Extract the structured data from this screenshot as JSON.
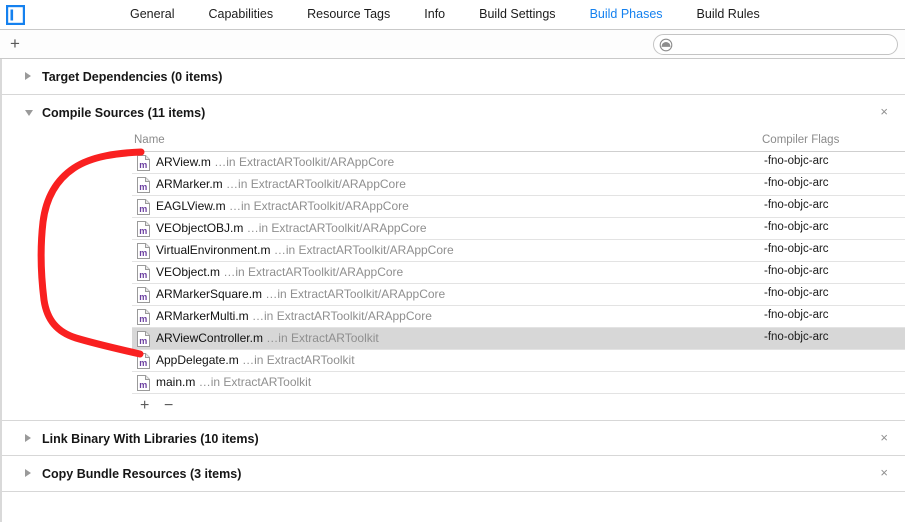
{
  "window": {
    "project_icon": "project-navigator-icon"
  },
  "tabs": [
    {
      "label": "General",
      "active": false
    },
    {
      "label": "Capabilities",
      "active": false
    },
    {
      "label": "Resource Tags",
      "active": false
    },
    {
      "label": "Info",
      "active": false
    },
    {
      "label": "Build Settings",
      "active": false
    },
    {
      "label": "Build Phases",
      "active": true
    },
    {
      "label": "Build Rules",
      "active": false
    }
  ],
  "toolbar": {
    "add_phase_label": "+",
    "add_phase_icon": "plus-icon",
    "search_icon": "filter-circle-icon",
    "search_value": "",
    "search_placeholder": ""
  },
  "phases": [
    {
      "name": "target-dependencies",
      "title": "Target Dependencies (0 items)",
      "expanded": false,
      "closable": false,
      "close_label": ""
    },
    {
      "name": "compile-sources",
      "title": "Compile Sources (11 items)",
      "expanded": true,
      "closable": true,
      "close_label": "×"
    },
    {
      "name": "link-binary-with-libraries",
      "title": "Link Binary With Libraries (10 items)",
      "expanded": false,
      "closable": true,
      "close_label": "×"
    },
    {
      "name": "copy-bundle-resources",
      "title": "Copy Bundle Resources (3 items)",
      "expanded": false,
      "closable": true,
      "close_label": "×"
    }
  ],
  "file_table": {
    "columns": [
      "Name",
      "Compiler Flags"
    ],
    "footer": {
      "add_label": "+",
      "remove_label": "−"
    },
    "rows": [
      {
        "icon": "objc-m-file-icon",
        "name": "ARView.m",
        "path": "…in ExtractARToolkit/ARAppCore",
        "flags": "-fno-objc-arc",
        "selected": false
      },
      {
        "icon": "objc-m-file-icon",
        "name": "ARMarker.m",
        "path": "…in ExtractARToolkit/ARAppCore",
        "flags": "-fno-objc-arc",
        "selected": false
      },
      {
        "icon": "objc-m-file-icon",
        "name": "EAGLView.m",
        "path": "…in ExtractARToolkit/ARAppCore",
        "flags": "-fno-objc-arc",
        "selected": false
      },
      {
        "icon": "objc-m-file-icon",
        "name": "VEObjectOBJ.m",
        "path": "…in ExtractARToolkit/ARAppCore",
        "flags": "-fno-objc-arc",
        "selected": false
      },
      {
        "icon": "objc-m-file-icon",
        "name": "VirtualEnvironment.m",
        "path": "…in ExtractARToolkit/ARAppCore",
        "flags": "-fno-objc-arc",
        "selected": false
      },
      {
        "icon": "objc-m-file-icon",
        "name": "VEObject.m",
        "path": "…in ExtractARToolkit/ARAppCore",
        "flags": "-fno-objc-arc",
        "selected": false
      },
      {
        "icon": "objc-m-file-icon",
        "name": "ARMarkerSquare.m",
        "path": "…in ExtractARToolkit/ARAppCore",
        "flags": "-fno-objc-arc",
        "selected": false
      },
      {
        "icon": "objc-m-file-icon",
        "name": "ARMarkerMulti.m",
        "path": "…in ExtractARToolkit/ARAppCore",
        "flags": "-fno-objc-arc",
        "selected": false
      },
      {
        "icon": "objc-m-file-icon",
        "name": "ARViewController.m",
        "path": "…in ExtractARToolkit",
        "flags": "-fno-objc-arc",
        "selected": true
      },
      {
        "icon": "objc-m-file-icon",
        "name": "AppDelegate.m",
        "path": "…in ExtractARToolkit",
        "flags": "",
        "selected": false
      },
      {
        "icon": "objc-m-file-icon",
        "name": "main.m",
        "path": "…in ExtractARToolkit",
        "flags": "",
        "selected": false
      }
    ]
  },
  "annotation": {
    "type": "hand-drawn-bracket",
    "color": "#f92020"
  },
  "colors": {
    "accent_blue": "#1581ef",
    "annotation_red": "#f92020",
    "selection_gray": "#d7d7d7",
    "file_icon_purple": "#6b3fa0"
  }
}
